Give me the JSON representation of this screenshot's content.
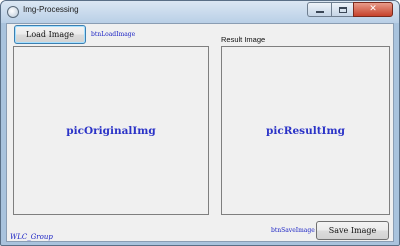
{
  "window": {
    "title": "Img-Processing",
    "icon": "app-icon",
    "controls": [
      "minimize-icon",
      "maximize-icon",
      "close-icon"
    ]
  },
  "toolbar": {
    "load_button": "Load Image",
    "load_button_name": "btnLoadImage"
  },
  "original": {
    "picture_name": "picOriginalImg"
  },
  "result": {
    "caption": "Result Image",
    "picture_name": "picResultImg"
  },
  "footer": {
    "save_button": "Save Image",
    "save_button_name": "btnSaveImage",
    "group_name": "WLC_Group"
  },
  "colors": {
    "design_label": "#1a22c4",
    "picture_label": "#2b33c7",
    "client_bg": "#f0f0f0",
    "frame": "#a9c3dd"
  }
}
